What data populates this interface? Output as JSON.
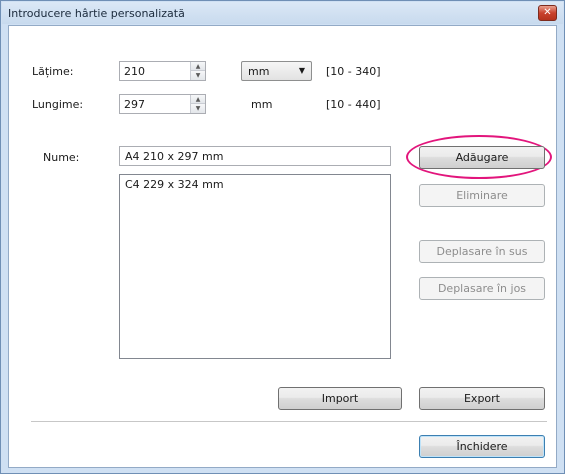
{
  "window": {
    "title": "Introducere hârtie personalizată",
    "close_symbol": "✕"
  },
  "width": {
    "label": "Lățime:",
    "value": "210",
    "unit_selected": "mm",
    "range": "[10 - 340]"
  },
  "length": {
    "label": "Lungime:",
    "value": "297",
    "unit": "mm",
    "range": "[10 - 440]"
  },
  "name": {
    "label": "Nume:",
    "value": "A4 210 x 297 mm"
  },
  "paper_list": {
    "items": [
      "C4 229 x 324 mm"
    ]
  },
  "buttons": {
    "add": "Adăugare",
    "remove": "Eliminare",
    "move_up": "Deplasare în sus",
    "move_down": "Deplasare în jos",
    "import": "Import",
    "export": "Export",
    "close": "Închidere"
  },
  "colors": {
    "highlight": "#e2157c"
  }
}
